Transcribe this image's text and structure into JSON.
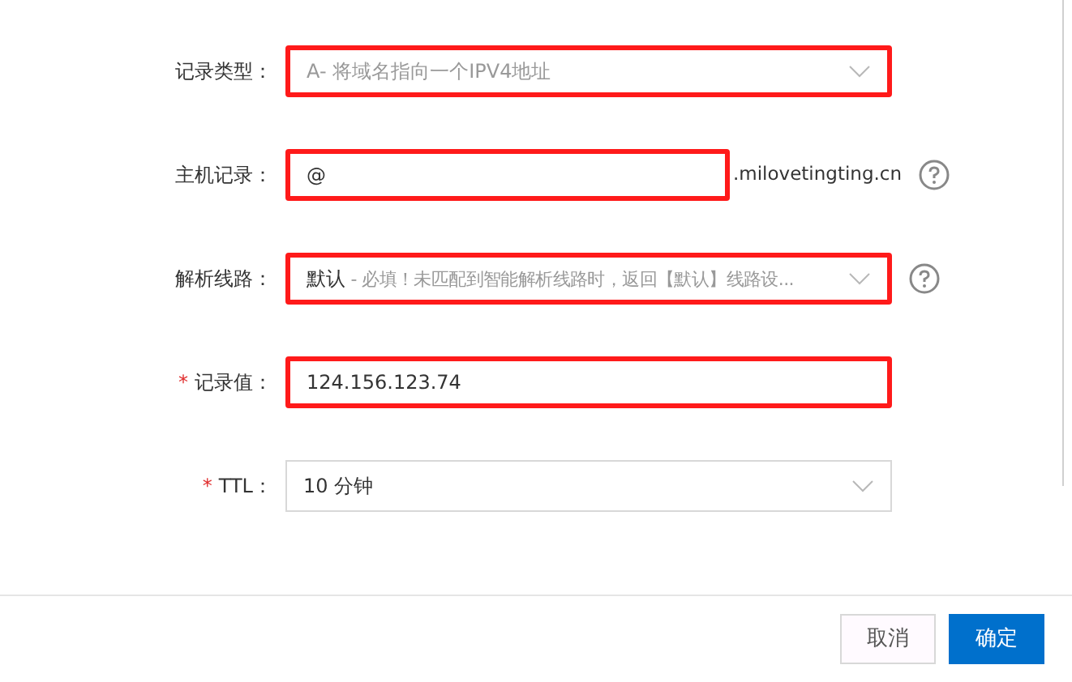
{
  "form": {
    "rows": [
      {
        "kind": "select",
        "label": "记录类型：",
        "highlighted": true,
        "placeholder": "A- 将域名指向一个IPV4地址"
      },
      {
        "kind": "input",
        "label": "主机记录：",
        "highlighted": true,
        "value": "@",
        "suffix": ".milovetingting.cn",
        "help": true
      },
      {
        "kind": "select",
        "label": "解析线路：",
        "highlighted": true,
        "value": "默认",
        "hint": "- 必填！未匹配到智能解析线路时，返回【默认】线路设...",
        "help": true
      },
      {
        "kind": "input",
        "label": "记录值：",
        "required_mark": "*",
        "highlighted": true,
        "value": "124.156.123.74"
      },
      {
        "kind": "select",
        "label": "TTL：",
        "required_mark": "*",
        "highlighted": false,
        "value": "10 分钟"
      }
    ]
  },
  "footer": {
    "buttons": [
      {
        "label": "取消",
        "kind": "secondary"
      },
      {
        "label": "确定",
        "kind": "primary"
      }
    ]
  }
}
